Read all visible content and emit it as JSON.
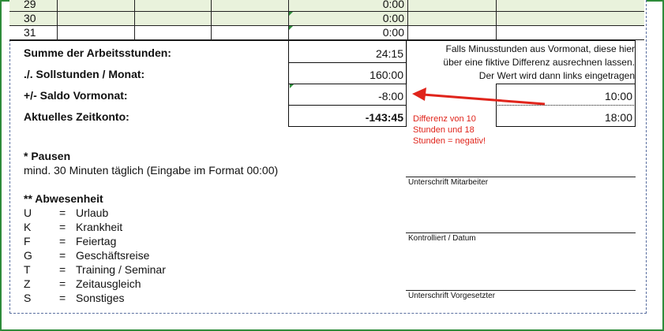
{
  "rows": [
    {
      "day": "29",
      "time": "0:00"
    },
    {
      "day": "30",
      "time": "0:00"
    },
    {
      "day": "31",
      "time": "0:00"
    }
  ],
  "summary": {
    "total_label": "Summe der Arbeitsstunden:",
    "total_value": "24:15",
    "target_label": "./. Sollstunden / Monat:",
    "target_value": "160:00",
    "balance_label": "+/- Saldo Vormonat:",
    "balance_value": "-8:00",
    "account_label": "Aktuelles Zeitkonto:",
    "account_value": "-143:45"
  },
  "helper": {
    "note_line1": "Falls Minusstunden aus Vormonat, diese hier",
    "note_line2": "über eine fiktive Differenz ausrechnen lassen.",
    "note_line3": "Der Wert wird dann links eingetragen",
    "value1": "10:00",
    "value2": "18:00"
  },
  "annotation": {
    "line1": "Differenz von 10",
    "line2": "Stunden und 18",
    "line3": "Stunden = negativ!",
    "color": "#e0241b"
  },
  "pausen": {
    "title": "* Pausen",
    "text": "mind. 30 Minuten täglich (Eingabe im Format 00:00)"
  },
  "abwesenheit": {
    "title": "** Abwesenheit",
    "items": [
      {
        "code": "U",
        "eq": "=",
        "desc": "Urlaub"
      },
      {
        "code": "K",
        "eq": "=",
        "desc": "Krankheit"
      },
      {
        "code": "F",
        "eq": "=",
        "desc": "Feiertag"
      },
      {
        "code": "G",
        "eq": "=",
        "desc": "Geschäftsreise"
      },
      {
        "code": "T",
        "eq": "=",
        "desc": "Training / Seminar"
      },
      {
        "code": "Z",
        "eq": "=",
        "desc": "Zeitausgleich"
      },
      {
        "code": "S",
        "eq": "=",
        "desc": "Sonstiges"
      }
    ]
  },
  "signatures": {
    "employee": "Unterschrift Mitarbeiter",
    "checked": "Kontrolliert / Datum",
    "supervisor": "Unterschrift Vorgesetzter"
  },
  "colors": {
    "row_fill": "#e9f2dc",
    "frame_green": "#2e8b3a",
    "arrow_red": "#e0241b"
  }
}
